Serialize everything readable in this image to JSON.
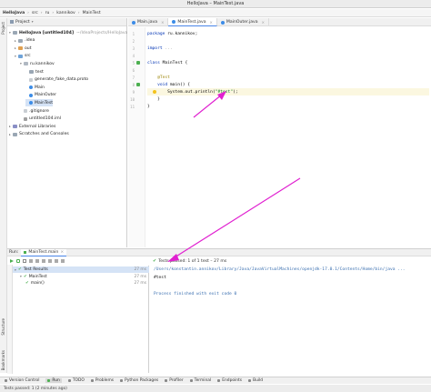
{
  "window": {
    "title": "HelloJava – MainTest.java"
  },
  "breadcrumb": [
    "HelloJava",
    "src",
    "ru",
    "kannikov",
    "MainTest"
  ],
  "project_panel": {
    "header_label": "Project",
    "tree": [
      {
        "label": "HelloJava [untitled104]",
        "path": "~/IdeaProjects/HelloJava",
        "indent": 0,
        "arrow": "▾",
        "icon": "folder",
        "bold": true
      },
      {
        "label": ".idea",
        "indent": 1,
        "arrow": "▸",
        "icon": "folder"
      },
      {
        "label": "out",
        "indent": 1,
        "arrow": "▸",
        "icon": "folder-out"
      },
      {
        "label": "src",
        "indent": 1,
        "arrow": "▾",
        "icon": "folder-src"
      },
      {
        "label": "ru.kannikov",
        "indent": 2,
        "arrow": "▾",
        "icon": "pkg"
      },
      {
        "label": "test",
        "indent": 3,
        "arrow": "",
        "icon": "folder"
      },
      {
        "label": "generate_fake_data.proto",
        "indent": 3,
        "arrow": "",
        "icon": "file"
      },
      {
        "label": "Main",
        "indent": 3,
        "arrow": "",
        "icon": "cls"
      },
      {
        "label": "MainOuter",
        "indent": 3,
        "arrow": "",
        "icon": "cls"
      },
      {
        "label": "MainTest",
        "indent": 3,
        "arrow": "",
        "icon": "cls"
      },
      {
        "label": ".gitignore",
        "indent": 2,
        "arrow": "",
        "icon": "file"
      },
      {
        "label": "untitled104.iml",
        "indent": 2,
        "arrow": "",
        "icon": "iml"
      },
      {
        "label": "External Libraries",
        "indent": 0,
        "arrow": "▸",
        "icon": "lib"
      },
      {
        "label": "Scratches and Consoles",
        "indent": 0,
        "arrow": "▸",
        "icon": "folder"
      }
    ]
  },
  "left_strip_labels": [
    "Project"
  ],
  "left_strip_bottom_labels": [
    "Structure",
    "Bookmarks"
  ],
  "editor_tabs": [
    {
      "label": "Main.java",
      "active": false
    },
    {
      "label": "MainTest.java",
      "active": true
    },
    {
      "label": "MainOuter.java",
      "active": false
    }
  ],
  "code_lines": [
    {
      "n": "1",
      "parts": [
        [
          "kw",
          "package "
        ],
        [
          "plain",
          "ru.kannikov;"
        ]
      ]
    },
    {
      "n": "2",
      "parts": []
    },
    {
      "n": "3",
      "parts": [
        [
          "kw",
          "import "
        ],
        [
          "fold",
          "..."
        ]
      ]
    },
    {
      "n": "4",
      "parts": []
    },
    {
      "n": "5",
      "parts": [
        [
          "kw",
          "class "
        ],
        [
          "plain",
          "MainTest {"
        ]
      ]
    },
    {
      "n": "6",
      "parts": []
    },
    {
      "n": "7",
      "parts": [
        [
          "an",
          "    @Test"
        ]
      ]
    },
    {
      "n": "8",
      "parts": [
        [
          "kw",
          "    void "
        ],
        [
          "plain",
          "main() {"
        ]
      ]
    },
    {
      "n": "9",
      "parts": [
        [
          "plain",
          "        System."
        ],
        [
          "plain",
          "out"
        ],
        [
          "plain",
          ".println("
        ],
        [
          "str",
          "\"#test\""
        ],
        [
          "plain",
          ");"
        ]
      ]
    },
    {
      "n": "10",
      "parts": [
        [
          "plain",
          "    }"
        ]
      ]
    },
    {
      "n": "11",
      "parts": [
        [
          "plain",
          "}"
        ]
      ]
    }
  ],
  "run_panel": {
    "run_label": "Run:",
    "config_tab": "MainTest.main",
    "status": "Tests passed: 1 of 1 test – 27 ms",
    "tests": [
      {
        "label": "Test Results",
        "time": "27 ms",
        "indent": 0
      },
      {
        "label": "MainTest",
        "time": "27 ms",
        "indent": 1
      },
      {
        "label": "main()",
        "time": "27 ms",
        "indent": 2
      }
    ],
    "console": [
      {
        "kind": "path",
        "text": "/Users/konstantin.annikov/Library/Java/JavaVirtualMachines/openjdk-17.0.1/Contents/Home/bin/java ..."
      },
      {
        "kind": "out",
        "text": "#test"
      },
      {
        "kind": "out",
        "text": ""
      },
      {
        "kind": "done",
        "text": "Process finished with exit code 0"
      }
    ]
  },
  "bottom_tools": [
    {
      "label": "Version Control",
      "active": false
    },
    {
      "label": "Run",
      "active": true
    },
    {
      "label": "TODO",
      "active": false
    },
    {
      "label": "Problems",
      "active": false
    },
    {
      "label": "Python Packages",
      "active": false
    },
    {
      "label": "Profiler",
      "active": false
    },
    {
      "label": "Terminal",
      "active": false
    },
    {
      "label": "Endpoints",
      "active": false
    },
    {
      "label": "Build",
      "active": false
    }
  ],
  "status_bar": {
    "text": "Tests passed: 1 (2 minutes ago)"
  },
  "colors": {
    "accent": "#4a86e8",
    "arrow": "#e020d0",
    "pass": "#4caf50"
  }
}
